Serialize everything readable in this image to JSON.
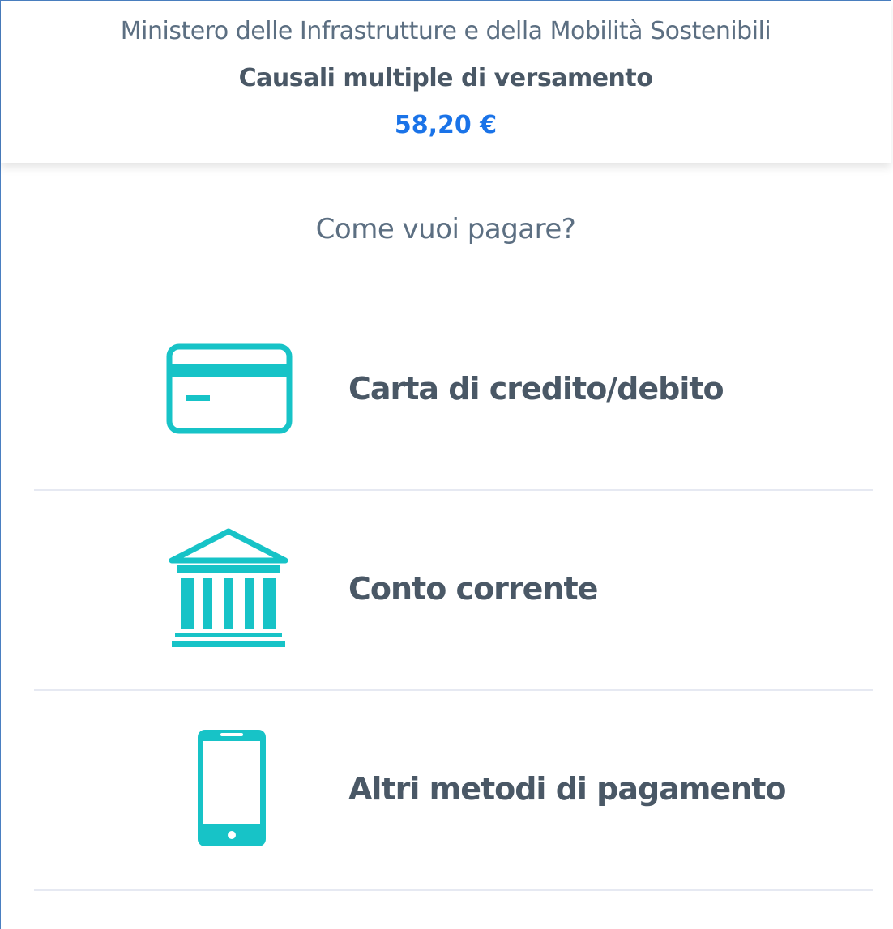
{
  "header": {
    "entity": "Ministero delle Infrastrutture e della Mobilità Sostenibili",
    "subject": "Causali multiple di versamento",
    "amount": "58,20 €"
  },
  "question": "Come vuoi pagare?",
  "methods": [
    {
      "label": "Carta di credito/debito",
      "icon": "credit-card-icon"
    },
    {
      "label": "Conto corrente",
      "icon": "bank-icon"
    },
    {
      "label": "Altri metodi di pagamento",
      "icon": "smartphone-icon"
    }
  ],
  "colors": {
    "accent": "#17C3C7",
    "amount": "#1A73E8",
    "text": "#5C6F82",
    "divider": "#E6E9F2"
  }
}
